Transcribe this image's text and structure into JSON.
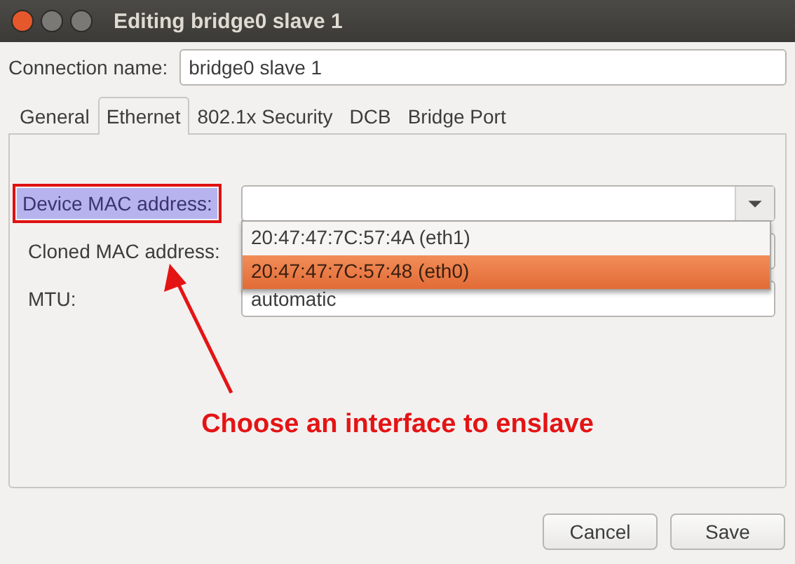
{
  "window": {
    "title": "Editing bridge0 slave 1"
  },
  "connection_name": {
    "label": "Connection name:",
    "value": "bridge0 slave 1"
  },
  "tabs": [
    {
      "label": "General",
      "selected": false
    },
    {
      "label": "Ethernet",
      "selected": true
    },
    {
      "label": "802.1x Security",
      "selected": false
    },
    {
      "label": "DCB",
      "selected": false
    },
    {
      "label": "Bridge Port",
      "selected": false
    }
  ],
  "fields": [
    {
      "label": "Device MAC address:",
      "highlighted": true,
      "dropdown_open": true
    },
    {
      "label": "Cloned MAC address:",
      "highlighted": false,
      "dropdown_open": false
    },
    {
      "label": "MTU:",
      "highlighted": false,
      "value": "automatic",
      "dropdown_open": false
    }
  ],
  "dropdown_options": [
    {
      "label": "20:47:47:7C:57:4A (eth1)",
      "selected": false
    },
    {
      "label": "20:47:47:7C:57:48 (eth0)",
      "selected": true
    }
  ],
  "annotation": {
    "text": "Choose an interface to enslave"
  },
  "buttons": [
    "Cancel",
    "Save"
  ]
}
